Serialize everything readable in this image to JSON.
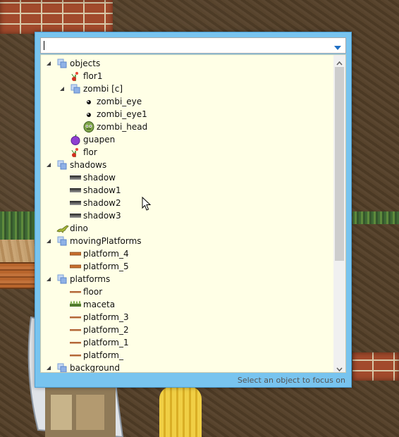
{
  "window": {
    "search": {
      "value": "",
      "placeholder": ""
    },
    "status_text": "Select an object to focus on"
  },
  "tree": [
    {
      "label": "objects",
      "kind": "group",
      "level": 0,
      "expanded": true,
      "icon": "group-icon"
    },
    {
      "label": "flor1",
      "kind": "item",
      "level": 1,
      "icon": "flower-sprite-icon"
    },
    {
      "label": "zombi [c]",
      "kind": "group",
      "level": 1,
      "expanded": true,
      "icon": "group-icon"
    },
    {
      "label": "zombi_eye",
      "kind": "item",
      "level": 2,
      "icon": "eye-sprite-icon"
    },
    {
      "label": "zombi_eye1",
      "kind": "item",
      "level": 2,
      "icon": "eye-sprite-icon"
    },
    {
      "label": "zombi_head",
      "kind": "item",
      "level": 2,
      "icon": "zombie-head-sprite-icon"
    },
    {
      "label": "guapen",
      "kind": "item",
      "level": 1,
      "icon": "purple-fruit-sprite-icon"
    },
    {
      "label": "flor",
      "kind": "item",
      "level": 1,
      "icon": "flower-sprite-icon"
    },
    {
      "label": "shadows",
      "kind": "group",
      "level": 0,
      "expanded": true,
      "icon": "group-icon"
    },
    {
      "label": "shadow",
      "kind": "item",
      "level": 1,
      "icon": "shadow-sprite-icon"
    },
    {
      "label": "shadow1",
      "kind": "item",
      "level": 1,
      "icon": "shadow-sprite-icon"
    },
    {
      "label": "shadow2",
      "kind": "item",
      "level": 1,
      "icon": "shadow-sprite-icon"
    },
    {
      "label": "shadow3",
      "kind": "item",
      "level": 1,
      "icon": "shadow-sprite-icon"
    },
    {
      "label": "dino",
      "kind": "item",
      "level": 0,
      "icon": "dino-sprite-icon"
    },
    {
      "label": "movingPlatforms",
      "kind": "group",
      "level": 0,
      "expanded": true,
      "icon": "group-icon"
    },
    {
      "label": "platform_4",
      "kind": "item",
      "level": 1,
      "icon": "platform-sprite-icon"
    },
    {
      "label": "platform_5",
      "kind": "item",
      "level": 1,
      "icon": "platform-sprite-icon"
    },
    {
      "label": "platforms",
      "kind": "group",
      "level": 0,
      "expanded": true,
      "icon": "group-icon"
    },
    {
      "label": "floor",
      "kind": "item",
      "level": 1,
      "icon": "floor-sprite-icon"
    },
    {
      "label": "maceta",
      "kind": "item",
      "level": 1,
      "icon": "grass-sprite-icon"
    },
    {
      "label": "platform_3",
      "kind": "item",
      "level": 1,
      "icon": "floor-sprite-icon"
    },
    {
      "label": "platform_2",
      "kind": "item",
      "level": 1,
      "icon": "floor-sprite-icon"
    },
    {
      "label": "platform_1",
      "kind": "item",
      "level": 1,
      "icon": "floor-sprite-icon"
    },
    {
      "label": "platform_",
      "kind": "item",
      "level": 1,
      "icon": "floor-sprite-icon"
    },
    {
      "label": "background",
      "kind": "group",
      "level": 0,
      "expanded": true,
      "icon": "group-icon"
    }
  ],
  "colors": {
    "window_frame": "#78c4ef",
    "tree_background": "#ffffe6",
    "group_icon": "#7aa0d8"
  }
}
